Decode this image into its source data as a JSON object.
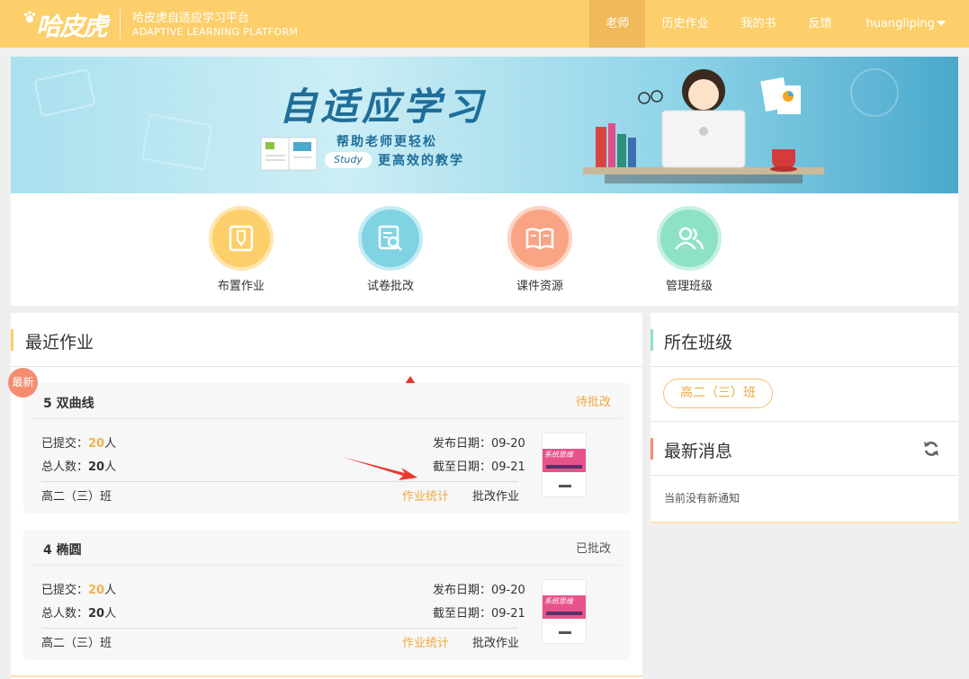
{
  "header": {
    "logo_text": "哈皮虎",
    "brand_cn": "哈皮虎自适应学习平台",
    "brand_en": "ADAPTIVE LEARNING PLATFORM",
    "nav": [
      {
        "label": "老师",
        "active": true
      },
      {
        "label": "历史作业",
        "active": false
      },
      {
        "label": "我的书",
        "active": false
      },
      {
        "label": "反馈",
        "active": false
      }
    ],
    "user": "huangliping"
  },
  "banner": {
    "title": "自适应学习",
    "sub1": "帮助老师更轻松",
    "pill": "Study",
    "sub2": "更高效的教学"
  },
  "quick_actions": [
    {
      "label": "布置作业",
      "icon": "pencil-doc-icon",
      "color": "#fccf6b"
    },
    {
      "label": "试卷批改",
      "icon": "magnify-doc-icon",
      "color": "#7fd3e3"
    },
    {
      "label": "课件资源",
      "icon": "open-book-icon",
      "color": "#f9a585"
    },
    {
      "label": "管理班级",
      "icon": "users-icon",
      "color": "#8ee2c4"
    }
  ],
  "recent": {
    "title": "最近作业",
    "new_badge": "最新",
    "cards": [
      {
        "title": "5 双曲线",
        "status": "待批改",
        "status_color": "#f0a93e",
        "submitted_label": "已提交：",
        "submitted": "20",
        "submitted_unit": "人",
        "total_label": "总人数：",
        "total": "20",
        "total_unit": "人",
        "publish": "发布日期：09-20",
        "deadline": "截至日期：09-21",
        "class": "高二（三）班",
        "stats_link": "作业统计",
        "grade_link": "批改作业",
        "book_text": "系统思维"
      },
      {
        "title": "4 椭圆",
        "status": "已批改",
        "status_color": "#555555",
        "submitted_label": "已提交：",
        "submitted": "20",
        "submitted_unit": "人",
        "total_label": "总人数：",
        "total": "20",
        "total_unit": "人",
        "publish": "发布日期：09-20",
        "deadline": "截至日期：09-21",
        "class": "高二（三）班",
        "stats_link": "作业统计",
        "grade_link": "批改作业",
        "book_text": "系统思维"
      }
    ]
  },
  "class_panel": {
    "title": "所在班级",
    "class_tag": "高二（三）班",
    "bar_color": "#8ee2c4"
  },
  "news_panel": {
    "title": "最新消息",
    "empty": "当前没有新通知",
    "bar_color": "#f58c70"
  }
}
